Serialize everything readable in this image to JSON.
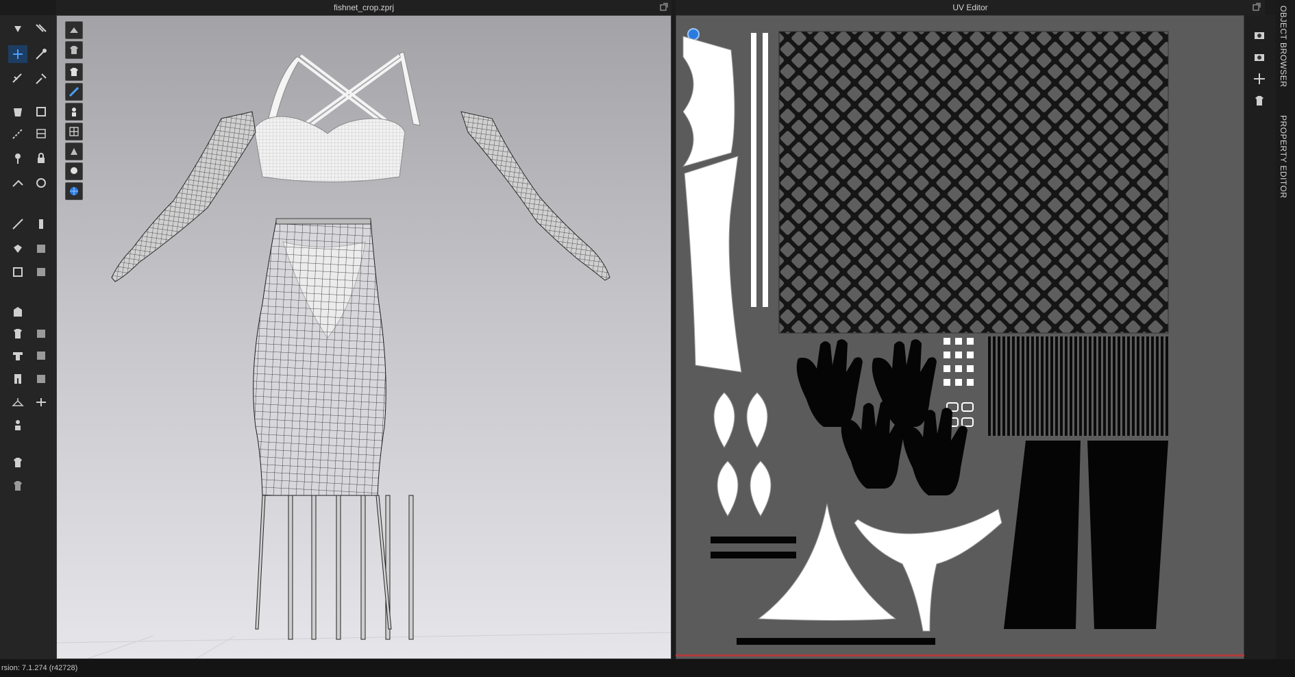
{
  "panels": {
    "viewport_3d": {
      "title": "fishnet_crop.zprj"
    },
    "uv_editor": {
      "title": "UV Editor"
    }
  },
  "side_tabs": {
    "object_browser": "OBJECT BROWSER",
    "property_editor": "PROPERTY EDITOR"
  },
  "status_bar": {
    "version_text": "rsion: 7.1.274 (r42728)"
  },
  "colors": {
    "accent_blue": "#2a7be0",
    "uv_background": "#5b5b5b",
    "uv_bottom_accent": "#b03a3a"
  },
  "icons": {
    "left_toolbar": [
      "select-move-icon",
      "transform-pattern-icon",
      "edit-point-icon",
      "add-point-icon",
      "fold-arrangement-icon",
      "gizmo-icon",
      "polygon-icon",
      "tape-icon",
      "sewing-icon",
      "seam-icon",
      "pin-icon",
      "lock-icon",
      "needle-icon",
      "pattern-edit-icon",
      "internal-line-icon",
      "button-icon",
      "trim-icon",
      "zip-icon",
      "avatar-icon",
      "measure-icon"
    ],
    "viewport_tools": [
      "avatar-view-icon",
      "garment-view-icon",
      "texture-view-icon",
      "pressure-view-icon",
      "skin-view-icon",
      "mesh-view-icon",
      "shaded-view-icon",
      "avatar-hide-icon",
      "render-globe-icon"
    ],
    "uv_tools": [
      "camera-capture-icon",
      "snapshot-icon",
      "uv-move-icon",
      "uv-arrange-icon"
    ]
  }
}
